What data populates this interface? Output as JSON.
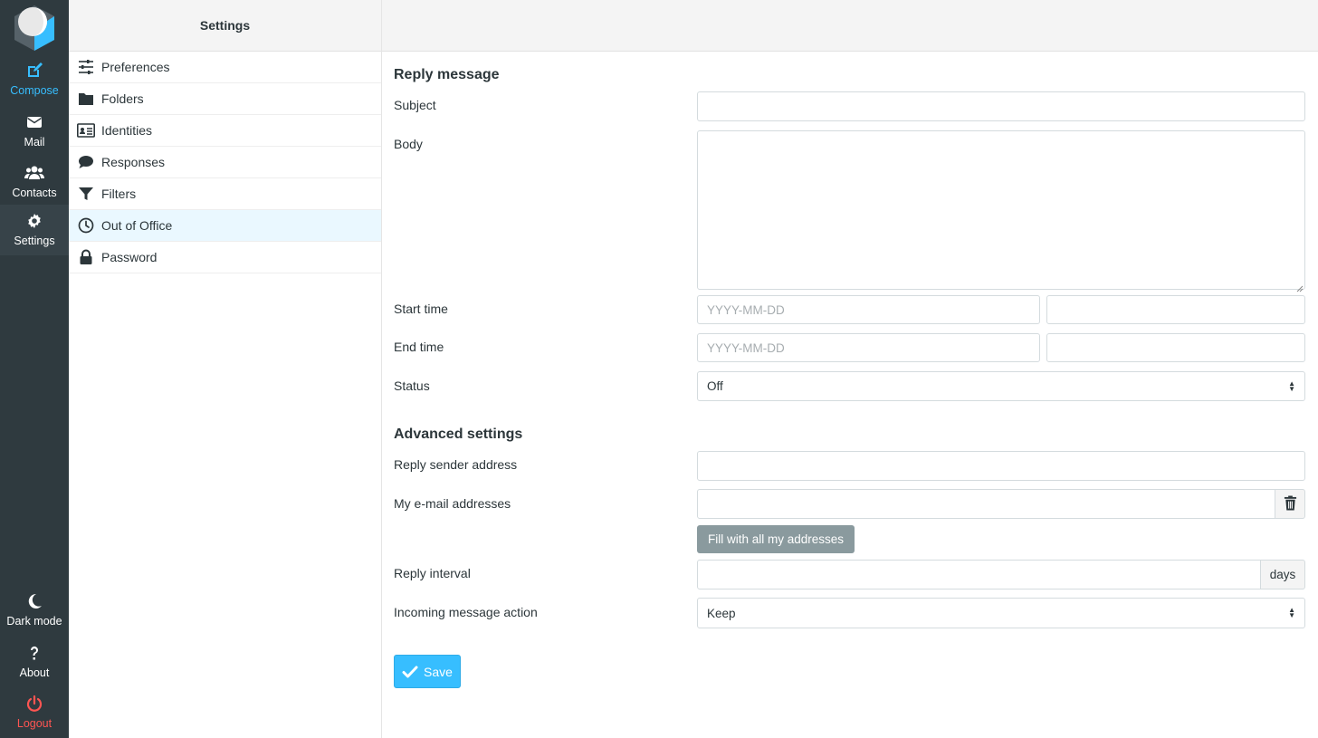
{
  "nav": {
    "compose": "Compose",
    "mail": "Mail",
    "contacts": "Contacts",
    "settings": "Settings",
    "dark_mode": "Dark mode",
    "about": "About",
    "logout": "Logout"
  },
  "settings_list": {
    "title": "Settings",
    "items": [
      {
        "label": "Preferences",
        "icon": "sliders-icon"
      },
      {
        "label": "Folders",
        "icon": "folder-icon"
      },
      {
        "label": "Identities",
        "icon": "id-card-icon"
      },
      {
        "label": "Responses",
        "icon": "comment-icon"
      },
      {
        "label": "Filters",
        "icon": "filter-icon"
      },
      {
        "label": "Out of Office",
        "icon": "clock-icon",
        "active": true
      },
      {
        "label": "Password",
        "icon": "lock-icon"
      }
    ]
  },
  "form": {
    "reply_title": "Reply message",
    "subject_label": "Subject",
    "subject_value": "",
    "body_label": "Body",
    "body_value": "",
    "start_label": "Start time",
    "start_date_placeholder": "YYYY-MM-DD",
    "start_time_value": "",
    "end_label": "End time",
    "end_date_placeholder": "YYYY-MM-DD",
    "end_time_value": "",
    "status_label": "Status",
    "status_value": "Off",
    "advanced_title": "Advanced settings",
    "sender_label": "Reply sender address",
    "sender_value": "",
    "addresses_label": "My e-mail addresses",
    "addresses_value": "",
    "fill_button": "Fill with all my addresses",
    "interval_label": "Reply interval",
    "interval_value": "",
    "interval_unit": "days",
    "action_label": "Incoming message action",
    "action_value": "Keep",
    "save_button": "Save"
  },
  "colors": {
    "accent": "#37beff",
    "nav_bg": "#2f3a3f",
    "logout": "#ff5552",
    "fill_button": "#8a9a9e"
  }
}
